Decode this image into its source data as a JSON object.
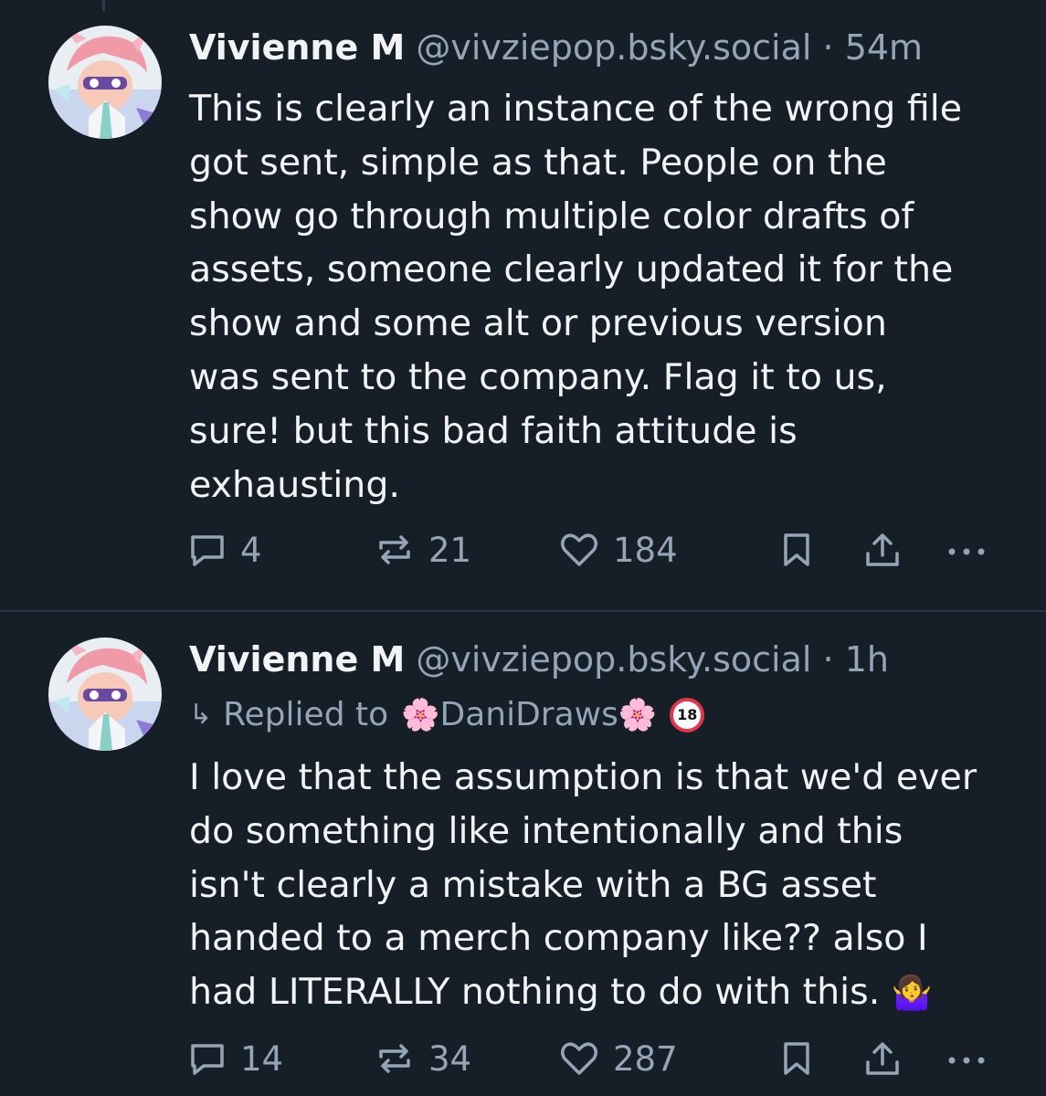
{
  "posts": [
    {
      "author": {
        "name": "Vivienne M",
        "handle": "@vivziepop.bsky.social"
      },
      "separator": "·",
      "time": "54m",
      "text": "This is clearly an instance of the wrong file\ngot sent, simple as that. People on the\nshow go through multiple color drafts of\nassets, someone clearly updated it for the\nshow and some alt or previous version\nwas sent to the company. Flag it to us,\nsure! but this bad faith attitude is\nexhausting.",
      "actions": {
        "replies": "4",
        "reposts": "21",
        "likes": "184"
      }
    },
    {
      "author": {
        "name": "Vivienne M",
        "handle": "@vivziepop.bsky.social"
      },
      "separator": "·",
      "time": "1h",
      "reply_to": {
        "label": "Replied to",
        "name": "DaniDraws",
        "badge": "18"
      },
      "text": "I love that the assumption is that we'd ever\ndo something like intentionally and this\nisn't clearly a mistake with a BG asset\nhanded to a merch company like?? also I\nhad LITERALLY nothing to do with this. ",
      "emoji": "🤷‍♀️",
      "actions": {
        "replies": "14",
        "reposts": "34",
        "likes": "287"
      }
    }
  ],
  "icons": {
    "reply": "reply-icon",
    "repost": "repost-icon",
    "like": "heart-icon",
    "bookmark": "bookmark-icon",
    "share": "share-icon",
    "more": "more-icon",
    "flower": "🌸"
  },
  "colors": {
    "background": "#161e27",
    "text": "#f1f3f5",
    "muted": "#93a5b7",
    "divider": "#2a3441"
  }
}
